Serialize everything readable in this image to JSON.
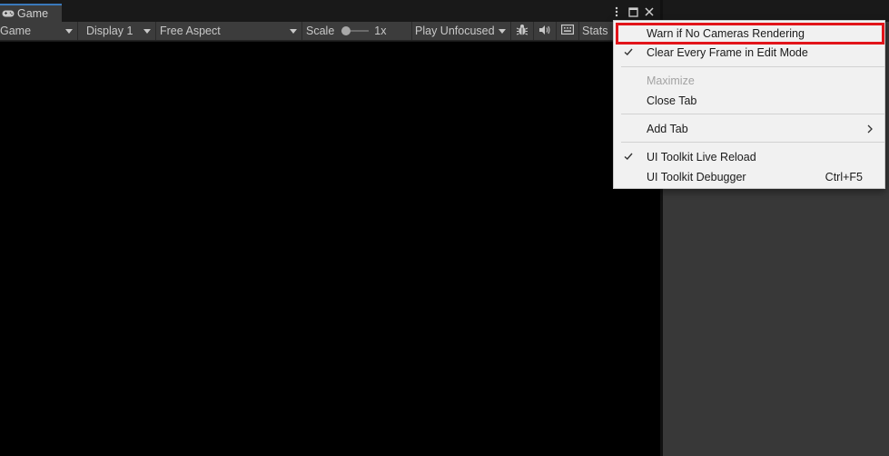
{
  "window": {
    "tab_label": "Game"
  },
  "toolbar": {
    "view_mode": "Game",
    "display": "Display 1",
    "aspect": "Free Aspect",
    "scale_label": "Scale",
    "scale_value": "1x",
    "play_mode": "Play Unfocused",
    "stats_label": "Stats"
  },
  "context_menu": {
    "items": [
      {
        "label": "Warn if No Cameras Rendering",
        "checked": false,
        "highlighted": true
      },
      {
        "label": "Clear Every Frame in Edit Mode",
        "checked": true
      },
      {
        "label": "Maximize",
        "disabled": true
      },
      {
        "label": "Close Tab"
      },
      {
        "label": "Add Tab",
        "submenu": true
      },
      {
        "label": "UI Toolkit Live Reload",
        "checked": true
      },
      {
        "label": "UI Toolkit Debugger",
        "shortcut": "Ctrl+F5"
      }
    ]
  },
  "colors": {
    "highlight_border": "#e2141a",
    "tab_accent": "#3a79bb"
  }
}
